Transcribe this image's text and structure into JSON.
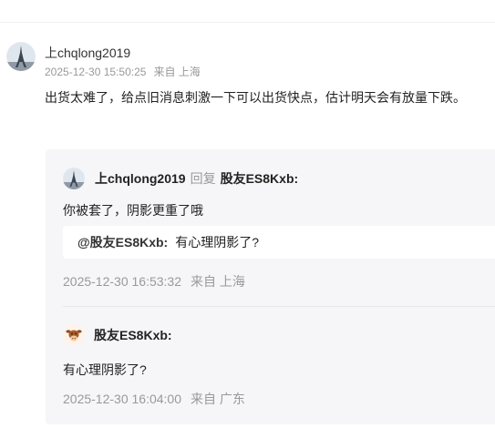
{
  "main_comment": {
    "avatar_icon": "eiffel-tower-avatar",
    "username": "上chqlong2019",
    "timestamp": "2025-12-30 15:50:25",
    "location": "来自 上海",
    "text": "出货太难了，给点旧消息刺激一下可以出货快点，估计明天会有放量下跌。"
  },
  "replies": [
    {
      "avatar_icon": "eiffel-tower-avatar",
      "username": "上chqlong2019",
      "reply_word": "回复",
      "reply_target": "股友ES8Kxb:",
      "text": "你被套了，阴影更重了哦",
      "quote": {
        "username": "@股友ES8Kxb:",
        "text": "有心理阴影了?"
      },
      "timestamp": "2025-12-30 16:53:32",
      "location": "来自 上海"
    },
    {
      "avatar_icon": "cow-avatar",
      "username": "股友ES8Kxb:",
      "text": "有心理阴影了?",
      "timestamp": "2025-12-30 16:04:00",
      "location": "来自 广东"
    }
  ],
  "colors": {
    "meta_gray": "#999999",
    "reply_background": "#f6f6f8",
    "quote_background": "#ffffff"
  }
}
